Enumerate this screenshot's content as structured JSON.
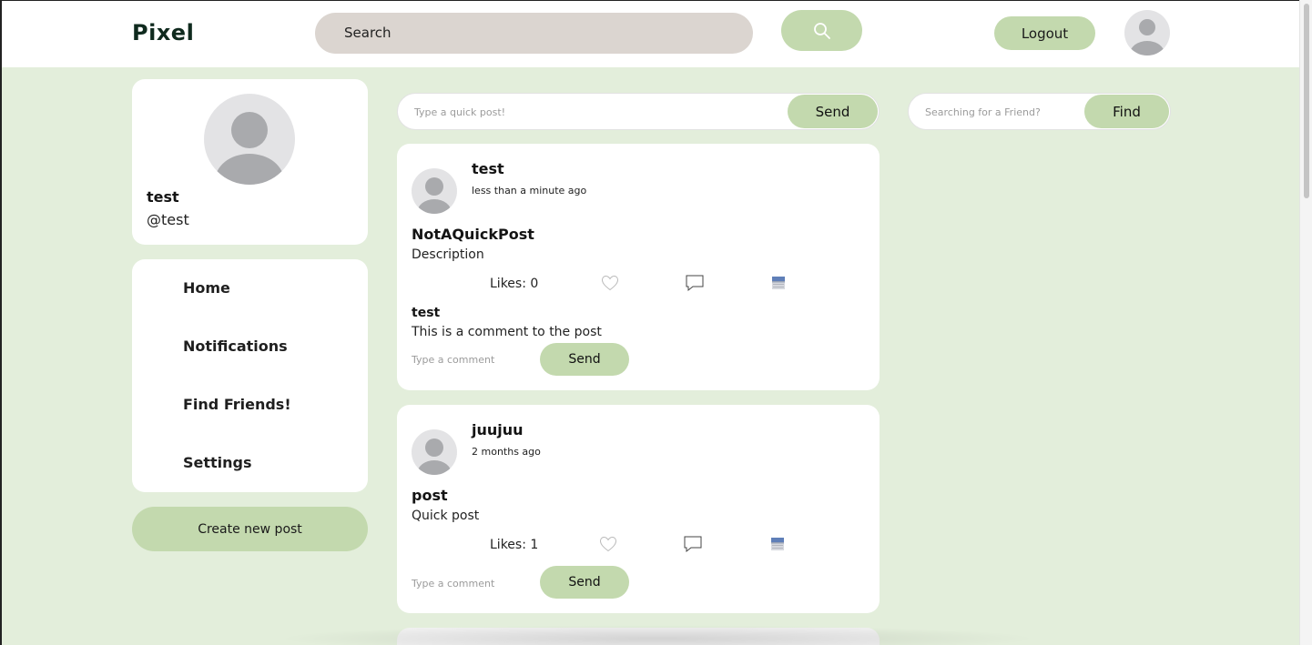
{
  "header": {
    "logo": "Pixel",
    "search_placeholder": "Search",
    "logout_label": "Logout"
  },
  "profile": {
    "name": "test",
    "handle": "@test"
  },
  "nav": {
    "items": [
      {
        "label": "Home"
      },
      {
        "label": "Notifications"
      },
      {
        "label": "Find Friends!"
      },
      {
        "label": "Settings"
      }
    ]
  },
  "create_post_label": "Create new post",
  "quick_post": {
    "placeholder": "Type a quick post!",
    "send_label": "Send"
  },
  "friend_search": {
    "placeholder": "Searching for a Friend?",
    "find_label": "Find"
  },
  "posts": [
    {
      "author": "test",
      "time": "less than a minute ago",
      "title": "NotAQuickPost",
      "description": "Description",
      "likes": "Likes: 0",
      "comments": [
        {
          "author": "test",
          "text": "This is a comment to the post"
        }
      ],
      "comment_placeholder": "Type a comment",
      "send_label": "Send"
    },
    {
      "author": "juujuu",
      "time": "2 months ago",
      "title": "post",
      "description": "Quick post",
      "likes": "Likes: 1",
      "comments": [],
      "comment_placeholder": "Type a comment",
      "send_label": "Send"
    }
  ],
  "icons": {
    "search": "search-icon",
    "like": "heart-icon",
    "comment": "speech-bubble-icon",
    "save": "archive-box-icon",
    "avatar": "user-avatar-icon"
  },
  "colors": {
    "accent": "#c3d9ae",
    "background": "#e3eedb",
    "search_bg": "#dbd5d0"
  }
}
